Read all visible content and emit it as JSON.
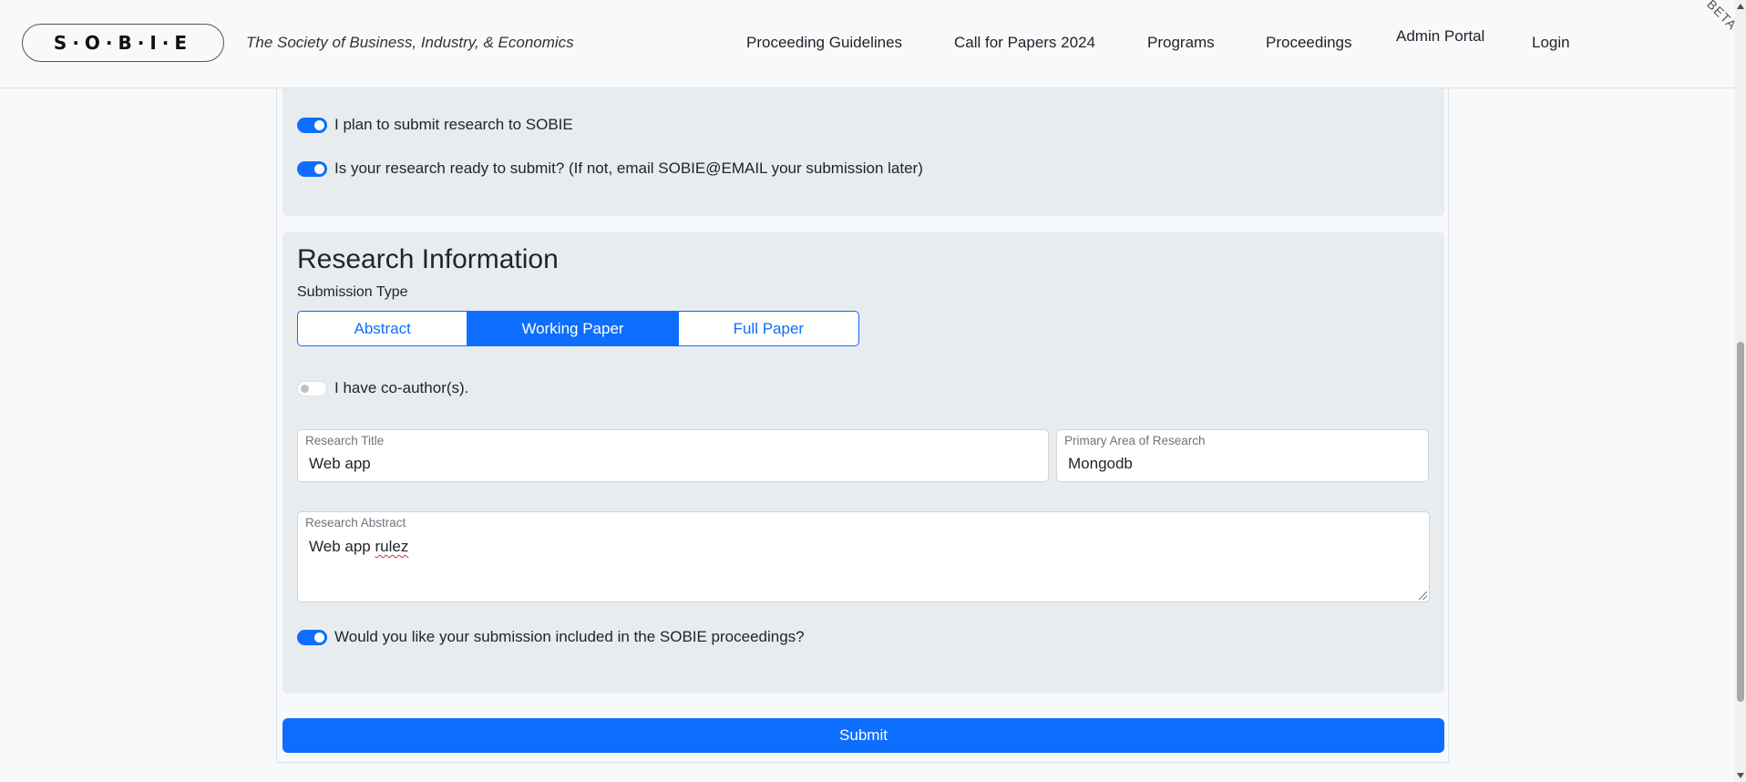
{
  "nav": {
    "brand": "S·O·B·I·E",
    "tagline": "The Society of Business, Industry, & Economics",
    "links": [
      "Proceeding Guidelines",
      "Call for Papers 2024",
      "Programs",
      "Proceedings",
      "Admin Portal",
      "Login"
    ],
    "beta": "BETA"
  },
  "top_card": {
    "toggle_submit": {
      "label": "I plan to submit research to SOBIE",
      "checked": true
    },
    "toggle_ready": {
      "label": "Is your research ready to submit? (If not, email SOBIE@EMAIL your submission later)",
      "checked": true
    }
  },
  "research": {
    "title": "Research Information",
    "submission_type_label": "Submission Type",
    "submission_types": [
      "Abstract",
      "Working Paper",
      "Full Paper"
    ],
    "selected_type": "Working Paper",
    "coauthor_toggle": {
      "label": "I have co-author(s).",
      "checked": false
    },
    "research_title": {
      "label": "Research Title",
      "value": "Web app"
    },
    "primary_area": {
      "label": "Primary Area of Research",
      "value": "Mongodb"
    },
    "abstract": {
      "label": "Research Abstract",
      "value_plain": "Web app ",
      "value_misspelled": "rulez"
    },
    "proceedings_toggle": {
      "label": "Would you like your submission included in the SOBIE proceedings?",
      "checked": true
    }
  },
  "submit_label": "Submit",
  "colors": {
    "primary": "#0d6efd",
    "card_bg": "#e9ecef",
    "page_bg": "#f8f9fa"
  }
}
